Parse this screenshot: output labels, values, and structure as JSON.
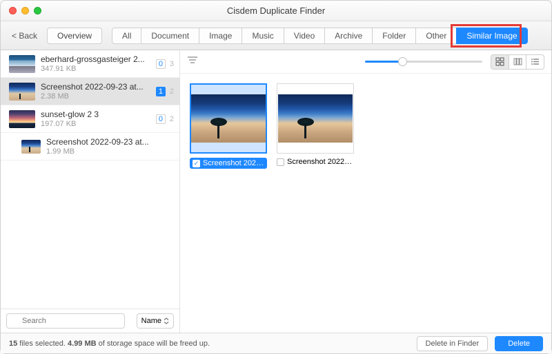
{
  "window": {
    "title": "Cisdem Duplicate Finder"
  },
  "toolbar": {
    "back": "< Back",
    "overview": "Overview",
    "tabs": [
      "All",
      "Document",
      "Image",
      "Music",
      "Video",
      "Archive",
      "Folder",
      "Other",
      "Similar Image"
    ],
    "active_index": 8
  },
  "sidebar": {
    "search_placeholder": "Search",
    "sort_label": "Name",
    "groups": [
      {
        "name": "eberhard-grossgasteiger 2...",
        "size": "347.91 KB",
        "selected_count": "0",
        "total_count": "3",
        "thumb": "sky",
        "selected": false,
        "indent": false
      },
      {
        "name": "Screenshot 2022-09-23 at...",
        "size": "2.38 MB",
        "selected_count": "1",
        "total_count": "2",
        "thumb": "tree",
        "selected": true,
        "indent": false
      },
      {
        "name": "sunset-glow 2 3",
        "size": "197.07 KB",
        "selected_count": "0",
        "total_count": "2",
        "thumb": "glow",
        "selected": false,
        "indent": false
      },
      {
        "name": "Screenshot 2022-09-23 at...",
        "size": "1.99 MB",
        "selected_count": "",
        "total_count": "",
        "thumb": "tree",
        "selected": false,
        "indent": true
      }
    ]
  },
  "main": {
    "items": [
      {
        "label": "Screenshot 2022-0...",
        "checked": true
      },
      {
        "label": "Screenshot 2022-0...",
        "checked": false
      }
    ]
  },
  "status": {
    "files_selected": "15",
    "text_mid": " files selected. ",
    "space": "4.99 MB",
    "text_tail": " of storage space will be freed up.",
    "delete_in_finder": "Delete in Finder",
    "delete": "Delete"
  },
  "icons": {
    "filter": "filter-icon",
    "grid": "grid-view-icon",
    "columns": "columns-view-icon",
    "list": "list-view-icon",
    "search": "search-icon",
    "chevron": "chevron-up-down-icon"
  }
}
